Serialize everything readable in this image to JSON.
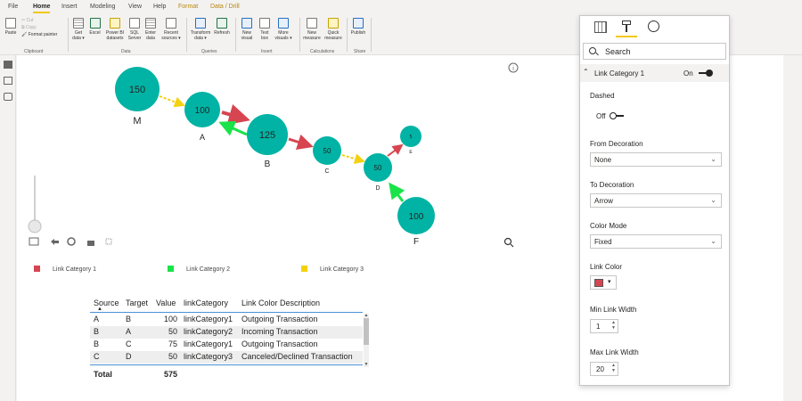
{
  "ribbon": {
    "tabs": [
      "File",
      "Home",
      "Insert",
      "Modeling",
      "View",
      "Help",
      "Format",
      "Data / Drill"
    ],
    "clipboard": {
      "paste": "Paste",
      "cut": "Cut",
      "copy": "Copy",
      "format_painter": "Format painter",
      "group": "Clipboard"
    },
    "data": {
      "items": [
        "Get data",
        "Excel",
        "Power BI datasets",
        "SQL Server",
        "Enter data",
        "Recent sources"
      ],
      "group": "Data"
    },
    "queries": {
      "items": [
        "Transform data",
        "Refresh"
      ],
      "group": "Queries"
    },
    "insert": {
      "items": [
        "New visual",
        "Text box",
        "More visuals"
      ],
      "group": "Insert"
    },
    "calculations": {
      "items": [
        "New measure",
        "Quick measure"
      ],
      "group": "Calculations"
    },
    "share": {
      "items": [
        "Publish"
      ],
      "group": "Share"
    }
  },
  "graph": {
    "nodes": [
      {
        "id": "M",
        "value": 150
      },
      {
        "id": "A",
        "value": 100
      },
      {
        "id": "B",
        "value": 125
      },
      {
        "id": "C",
        "value": 50
      },
      {
        "id": "D",
        "value": 50
      },
      {
        "id": "E",
        "value": 5
      },
      {
        "id": "F",
        "value": 100
      }
    ],
    "colors": {
      "node": "#00b3a4",
      "link_category_1": "#d64550",
      "link_category_2": "#1ae34a",
      "link_category_3": "#f4d10e"
    }
  },
  "legend": [
    "Link Category 1",
    "Link Category 2",
    "Link Category 3"
  ],
  "table": {
    "columns": [
      "Source",
      "Target",
      "Value",
      "linkCategory",
      "Link Color Description"
    ],
    "rows": [
      [
        "A",
        "B",
        "100",
        "linkCategory1",
        "Outgoing Transaction"
      ],
      [
        "B",
        "A",
        "50",
        "linkCategory2",
        "Incoming Transaction"
      ],
      [
        "B",
        "C",
        "75",
        "linkCategory1",
        "Outgoing Transaction"
      ],
      [
        "C",
        "D",
        "50",
        "linkCategory3",
        "Canceled/Declined Transaction"
      ]
    ],
    "total_label": "Total",
    "total_value": "575"
  },
  "pane": {
    "search_placeholder": "Search",
    "section_title": "Link Category 1",
    "section_toggle": "On",
    "dashed_label": "Dashed",
    "dashed_toggle": "Off",
    "from_decoration_label": "From Decoration",
    "from_decoration_value": "None",
    "to_decoration_label": "To Decoration",
    "to_decoration_value": "Arrow",
    "color_mode_label": "Color Mode",
    "color_mode_value": "Fixed",
    "link_color_label": "Link Color",
    "link_color_value": "#d64550",
    "min_link_width_label": "Min Link Width",
    "min_link_width_value": "1",
    "max_link_width_label": "Max Link Width",
    "max_link_width_value": "20"
  }
}
